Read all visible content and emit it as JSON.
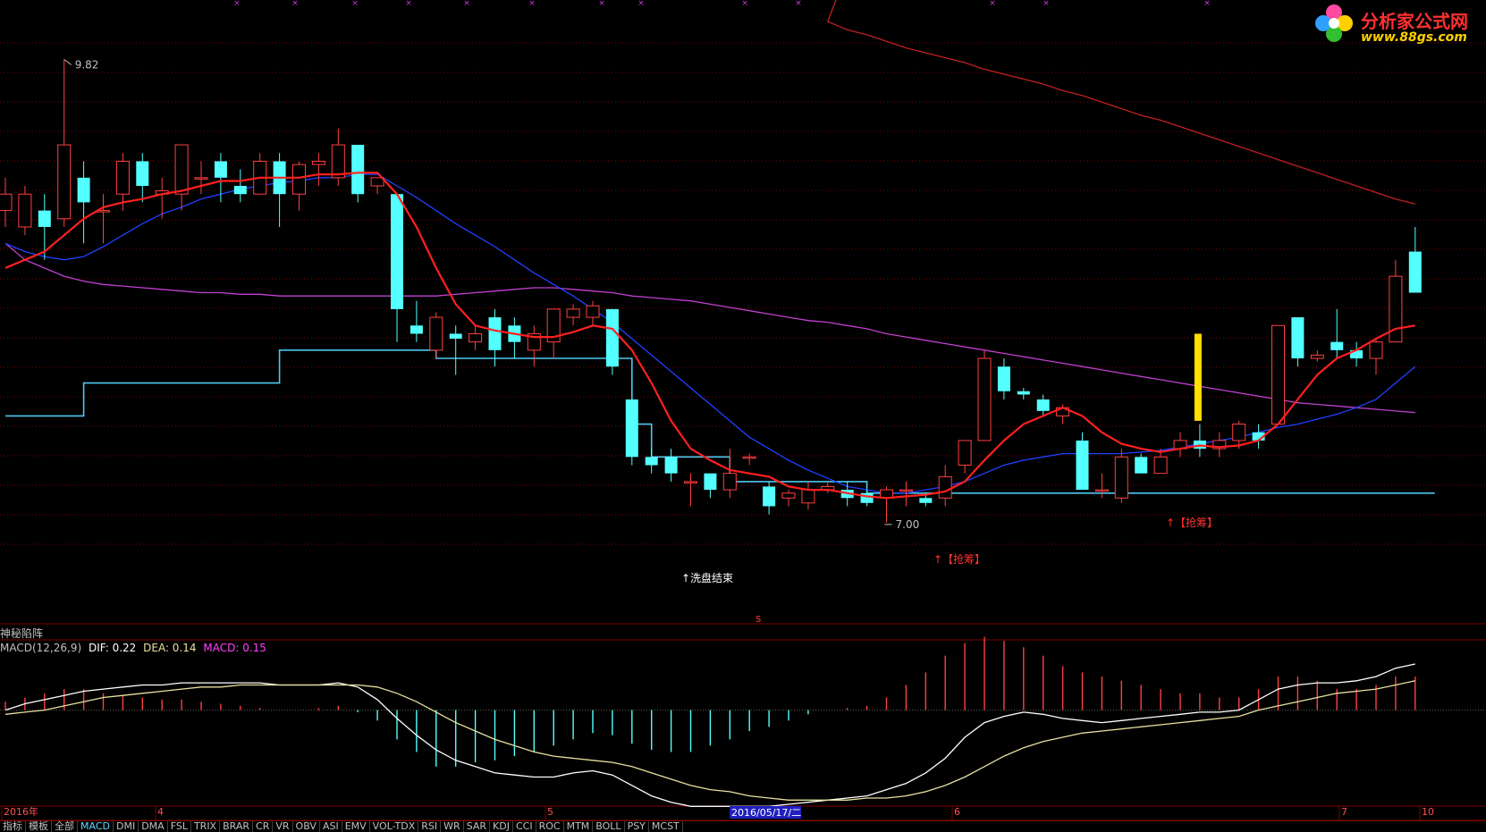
{
  "chart_data": {
    "type": "candlestick",
    "price_range": [
      6.7,
      10.1
    ],
    "candles": [
      [
        8.9,
        9.0,
        8.8,
        9.1
      ],
      [
        8.8,
        9.0,
        8.75,
        9.05
      ],
      [
        8.9,
        8.8,
        8.6,
        9.0
      ],
      [
        8.85,
        9.3,
        8.8,
        9.82
      ],
      [
        9.1,
        8.95,
        8.7,
        9.2
      ],
      [
        8.9,
        8.9,
        8.7,
        9.0
      ],
      [
        9.0,
        9.2,
        8.9,
        9.25
      ],
      [
        9.2,
        9.05,
        8.95,
        9.25
      ],
      [
        9.0,
        9.02,
        8.85,
        9.1
      ],
      [
        9.0,
        9.3,
        8.9,
        9.3
      ],
      [
        9.1,
        9.1,
        9.0,
        9.2
      ],
      [
        9.2,
        9.1,
        8.95,
        9.25
      ],
      [
        9.05,
        9.0,
        8.95,
        9.15
      ],
      [
        9.0,
        9.2,
        9.0,
        9.25
      ],
      [
        9.2,
        9.0,
        8.8,
        9.25
      ],
      [
        9.0,
        9.18,
        8.9,
        9.2
      ],
      [
        9.18,
        9.2,
        9.05,
        9.25
      ],
      [
        9.1,
        9.3,
        9.05,
        9.4
      ],
      [
        9.3,
        9.0,
        8.95,
        9.3
      ],
      [
        9.05,
        9.1,
        9.0,
        9.1
      ],
      [
        9.0,
        8.3,
        8.1,
        9.0
      ],
      [
        8.2,
        8.15,
        8.1,
        8.35
      ],
      [
        8.05,
        8.25,
        8.0,
        8.28
      ],
      [
        8.15,
        8.12,
        7.9,
        8.2
      ],
      [
        8.1,
        8.15,
        8.05,
        8.2
      ],
      [
        8.25,
        8.05,
        7.95,
        8.3
      ],
      [
        8.2,
        8.1,
        8.0,
        8.25
      ],
      [
        8.05,
        8.15,
        7.95,
        8.2
      ],
      [
        8.1,
        8.3,
        8.0,
        8.3
      ],
      [
        8.25,
        8.3,
        8.2,
        8.33
      ],
      [
        8.25,
        8.32,
        8.2,
        8.35
      ],
      [
        8.3,
        7.95,
        7.9,
        8.3
      ],
      [
        7.75,
        7.4,
        7.35,
        7.75
      ],
      [
        7.4,
        7.35,
        7.3,
        7.45
      ],
      [
        7.4,
        7.3,
        7.25,
        7.45
      ],
      [
        7.25,
        7.25,
        7.1,
        7.3
      ],
      [
        7.3,
        7.2,
        7.15,
        7.3
      ],
      [
        7.2,
        7.3,
        7.15,
        7.45
      ],
      [
        7.4,
        7.4,
        7.35,
        7.42
      ],
      [
        7.22,
        7.1,
        7.05,
        7.25
      ],
      [
        7.15,
        7.18,
        7.1,
        7.2
      ],
      [
        7.12,
        7.2,
        7.08,
        7.25
      ],
      [
        7.2,
        7.22,
        7.18,
        7.25
      ],
      [
        7.2,
        7.15,
        7.1,
        7.25
      ],
      [
        7.18,
        7.12,
        7.1,
        7.2
      ],
      [
        7.15,
        7.2,
        7.0,
        7.22
      ],
      [
        7.2,
        7.2,
        7.1,
        7.25
      ],
      [
        7.15,
        7.12,
        7.1,
        7.18
      ],
      [
        7.15,
        7.28,
        7.1,
        7.35
      ],
      [
        7.35,
        7.5,
        7.3,
        7.5
      ],
      [
        7.5,
        8.0,
        7.5,
        8.05
      ],
      [
        7.95,
        7.8,
        7.75,
        8.0
      ],
      [
        7.8,
        7.78,
        7.75,
        7.82
      ],
      [
        7.75,
        7.68,
        7.65,
        7.78
      ],
      [
        7.65,
        7.7,
        7.6,
        7.72
      ],
      [
        7.5,
        7.2,
        7.2,
        7.55
      ],
      [
        7.2,
        7.2,
        7.15,
        7.3
      ],
      [
        7.15,
        7.4,
        7.12,
        7.45
      ],
      [
        7.4,
        7.3,
        7.3,
        7.42
      ],
      [
        7.3,
        7.4,
        7.3,
        7.45
      ],
      [
        7.45,
        7.5,
        7.4,
        7.55
      ],
      [
        7.5,
        7.45,
        7.4,
        7.6
      ],
      [
        7.45,
        7.5,
        7.4,
        7.55
      ],
      [
        7.5,
        7.6,
        7.45,
        7.62
      ],
      [
        7.55,
        7.5,
        7.45,
        7.6
      ],
      [
        7.6,
        8.2,
        7.6,
        8.2
      ],
      [
        8.25,
        8.0,
        7.95,
        8.25
      ],
      [
        8.0,
        8.02,
        7.98,
        8.05
      ],
      [
        8.1,
        8.05,
        8.0,
        8.3
      ],
      [
        8.05,
        8.0,
        7.95,
        8.1
      ],
      [
        8.0,
        8.1,
        7.9,
        8.12
      ],
      [
        8.1,
        8.5,
        8.1,
        8.6
      ],
      [
        8.65,
        8.4,
        8.4,
        8.8
      ]
    ],
    "labels": {
      "high": "9.82",
      "low": "7.00",
      "wash_end": "↑洗盘结束",
      "grab_1": "↑【抢筹】",
      "grab_2": "↑【抢筹】"
    },
    "ma_short": [
      8.55,
      8.6,
      8.65,
      8.75,
      8.85,
      8.92,
      8.95,
      8.97,
      9.0,
      9.02,
      9.05,
      9.08,
      9.08,
      9.1,
      9.1,
      9.1,
      9.12,
      9.12,
      9.13,
      9.13,
      9.0,
      8.8,
      8.55,
      8.33,
      8.2,
      8.17,
      8.15,
      8.13,
      8.13,
      8.16,
      8.2,
      8.18,
      8.05,
      7.85,
      7.62,
      7.45,
      7.38,
      7.32,
      7.3,
      7.28,
      7.22,
      7.2,
      7.2,
      7.18,
      7.16,
      7.15,
      7.16,
      7.17,
      7.19,
      7.25,
      7.38,
      7.5,
      7.6,
      7.65,
      7.7,
      7.65,
      7.55,
      7.48,
      7.45,
      7.43,
      7.45,
      7.47,
      7.46,
      7.47,
      7.5,
      7.6,
      7.75,
      7.9,
      8.0,
      8.05,
      8.12,
      8.18,
      8.2
    ],
    "ma_mid": [
      8.7,
      8.65,
      8.62,
      8.6,
      8.62,
      8.68,
      8.75,
      8.82,
      8.88,
      8.92,
      8.97,
      9.0,
      9.03,
      9.05,
      9.07,
      9.08,
      9.1,
      9.1,
      9.12,
      9.12,
      9.05,
      8.98,
      8.9,
      8.82,
      8.75,
      8.68,
      8.6,
      8.52,
      8.45,
      8.38,
      8.3,
      8.22,
      8.12,
      8.02,
      7.92,
      7.82,
      7.72,
      7.62,
      7.52,
      7.45,
      7.38,
      7.32,
      7.27,
      7.22,
      7.2,
      7.18,
      7.18,
      7.2,
      7.22,
      7.25,
      7.3,
      7.35,
      7.38,
      7.4,
      7.42,
      7.42,
      7.42,
      7.42,
      7.43,
      7.44,
      7.46,
      7.48,
      7.5,
      7.52,
      7.55,
      7.58,
      7.6,
      7.63,
      7.66,
      7.7,
      7.75,
      7.85,
      7.95
    ],
    "ma_long": [
      8.7,
      8.6,
      8.55,
      8.5,
      8.47,
      8.45,
      8.44,
      8.43,
      8.42,
      8.41,
      8.4,
      8.4,
      8.39,
      8.39,
      8.38,
      8.38,
      8.38,
      8.38,
      8.38,
      8.38,
      8.38,
      8.38,
      8.38,
      8.39,
      8.4,
      8.41,
      8.42,
      8.43,
      8.43,
      8.42,
      8.41,
      8.4,
      8.38,
      8.37,
      8.36,
      8.35,
      8.33,
      8.31,
      8.29,
      8.27,
      8.25,
      8.23,
      8.22,
      8.2,
      8.18,
      8.15,
      8.13,
      8.11,
      8.09,
      8.07,
      8.05,
      8.03,
      8.01,
      7.99,
      7.97,
      7.95,
      7.93,
      7.91,
      7.89,
      7.87,
      7.85,
      7.83,
      7.81,
      7.79,
      7.77,
      7.75,
      7.73,
      7.72,
      7.71,
      7.7,
      7.69,
      7.68,
      7.67
    ],
    "ma_very_long": [
      11.8,
      11.8,
      11.8,
      11.8,
      11.8,
      11.8,
      11.8,
      11.8,
      11.8,
      11.8,
      11.8,
      11.8,
      11.8,
      11.8,
      11.8,
      11.8,
      11.8,
      11.8,
      11.8,
      11.8,
      11.8,
      11.8,
      11.8,
      11.8,
      11.8,
      11.8,
      11.8,
      11.8,
      11.8,
      11.8,
      11.8,
      11.8,
      11.8,
      11.8,
      11.8,
      11.8,
      11.8,
      11.8,
      11.8,
      11.8,
      11.8,
      11.8,
      10.05,
      10.0,
      9.97,
      9.93,
      9.89,
      9.86,
      9.83,
      9.8,
      9.76,
      9.73,
      9.7,
      9.67,
      9.63,
      9.6,
      9.56,
      9.52,
      9.48,
      9.45,
      9.41,
      9.37,
      9.33,
      9.29,
      9.25,
      9.21,
      9.17,
      9.13,
      9.09,
      9.05,
      9.01,
      8.97,
      8.94
    ],
    "support_steps": [
      [
        0,
        7.65
      ],
      [
        3,
        7.65
      ],
      [
        4,
        7.85
      ],
      [
        12,
        7.85
      ],
      [
        14,
        8.05
      ],
      [
        21,
        8.05
      ],
      [
        22,
        8.0
      ],
      [
        30,
        8.0
      ],
      [
        32,
        7.6
      ],
      [
        33,
        7.4
      ],
      [
        37,
        7.25
      ],
      [
        40,
        7.25
      ],
      [
        44,
        7.18
      ],
      [
        73,
        7.18
      ]
    ],
    "macd": {
      "title": "MACD(12,26,9)",
      "dif": "DIF: 0.22",
      "dea": "DEA: 0.14",
      "macd": "MACD: 0.15",
      "range": [
        -0.45,
        0.25
      ],
      "dif_line": [
        0.0,
        0.03,
        0.05,
        0.07,
        0.09,
        0.1,
        0.11,
        0.12,
        0.12,
        0.13,
        0.13,
        0.13,
        0.13,
        0.13,
        0.12,
        0.12,
        0.12,
        0.13,
        0.11,
        0.05,
        -0.04,
        -0.12,
        -0.19,
        -0.24,
        -0.27,
        -0.3,
        -0.31,
        -0.32,
        -0.32,
        -0.3,
        -0.29,
        -0.31,
        -0.36,
        -0.41,
        -0.44,
        -0.46,
        -0.46,
        -0.46,
        -0.46,
        -0.46,
        -0.45,
        -0.44,
        -0.43,
        -0.42,
        -0.41,
        -0.38,
        -0.35,
        -0.3,
        -0.23,
        -0.13,
        -0.06,
        -0.03,
        -0.01,
        -0.02,
        -0.04,
        -0.05,
        -0.06,
        -0.05,
        -0.04,
        -0.03,
        -0.02,
        -0.01,
        -0.01,
        0.0,
        0.05,
        0.1,
        0.12,
        0.13,
        0.13,
        0.14,
        0.16,
        0.2,
        0.22
      ],
      "dea_line": [
        -0.02,
        -0.01,
        0.0,
        0.02,
        0.04,
        0.06,
        0.07,
        0.08,
        0.09,
        0.1,
        0.11,
        0.11,
        0.12,
        0.12,
        0.12,
        0.12,
        0.12,
        0.12,
        0.12,
        0.11,
        0.08,
        0.04,
        -0.01,
        -0.06,
        -0.1,
        -0.14,
        -0.17,
        -0.2,
        -0.22,
        -0.23,
        -0.24,
        -0.25,
        -0.27,
        -0.3,
        -0.33,
        -0.36,
        -0.38,
        -0.39,
        -0.41,
        -0.42,
        -0.43,
        -0.43,
        -0.43,
        -0.43,
        -0.42,
        -0.42,
        -0.41,
        -0.39,
        -0.36,
        -0.32,
        -0.27,
        -0.22,
        -0.18,
        -0.15,
        -0.13,
        -0.11,
        -0.1,
        -0.09,
        -0.08,
        -0.07,
        -0.06,
        -0.05,
        -0.04,
        -0.03,
        0.0,
        0.02,
        0.04,
        0.06,
        0.08,
        0.09,
        0.1,
        0.12,
        0.14
      ],
      "hist": [
        0.04,
        0.06,
        0.08,
        0.1,
        0.1,
        0.08,
        0.07,
        0.06,
        0.05,
        0.05,
        0.04,
        0.03,
        0.02,
        0.01,
        0.0,
        0.0,
        0.01,
        0.02,
        -0.01,
        -0.05,
        -0.14,
        -0.2,
        -0.27,
        -0.27,
        -0.25,
        -0.24,
        -0.22,
        -0.2,
        -0.17,
        -0.14,
        -0.11,
        -0.12,
        -0.16,
        -0.19,
        -0.2,
        -0.2,
        -0.17,
        -0.14,
        -0.1,
        -0.08,
        -0.05,
        -0.02,
        0.0,
        0.01,
        0.02,
        0.06,
        0.12,
        0.18,
        0.26,
        0.32,
        0.35,
        0.33,
        0.3,
        0.26,
        0.21,
        0.18,
        0.16,
        0.14,
        0.12,
        0.1,
        0.08,
        0.08,
        0.06,
        0.06,
        0.1,
        0.16,
        0.16,
        0.14,
        0.1,
        0.1,
        0.12,
        0.16,
        0.16
      ]
    }
  },
  "panel_title": "神秘陷阵",
  "marker_s": "s",
  "axis": {
    "year": "2016年",
    "m4": "4",
    "m5": "5",
    "cursor_date": "2016/05/17/二",
    "m6": "6",
    "m7": "7",
    "m10": "10"
  },
  "toolbar": [
    "指标",
    "模板",
    "全部",
    "MACD",
    "DMI",
    "DMA",
    "FSL",
    "TRIX",
    "BRAR",
    "CR",
    "VR",
    "OBV",
    "ASI",
    "EMV",
    "VOL-TDX",
    "RSI",
    "WR",
    "SAR",
    "KDJ",
    "CCI",
    "ROC",
    "MTM",
    "BOLL",
    "PSY",
    "MCST"
  ],
  "logo": {
    "title": "分析家公式网",
    "url": "www.88gs.com"
  },
  "colors": {
    "up": "#ff4040",
    "down": "#54ffff",
    "ma_short": "#ff2020",
    "ma_mid": "#2040ff",
    "ma_long": "#c040d0",
    "ma_very_long": "#c02020",
    "support": "#4ec8f0",
    "grid": "#800000",
    "highlight": "#ffe000"
  }
}
